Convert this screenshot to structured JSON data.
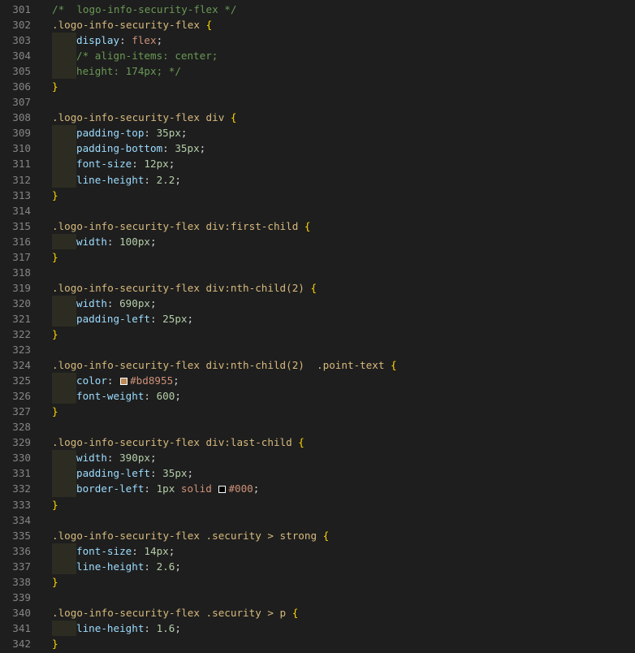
{
  "editor": {
    "lines": [
      {
        "n": "301",
        "indent": false,
        "tokens": [
          {
            "c": "cmt",
            "t": "/*  logo-info-security-flex */"
          }
        ]
      },
      {
        "n": "302",
        "indent": false,
        "tokens": [
          {
            "c": "sel",
            "t": ".logo-info-security-flex "
          },
          {
            "c": "br",
            "t": "{"
          }
        ]
      },
      {
        "n": "303",
        "indent": true,
        "tokens": [
          {
            "c": "prop",
            "t": "display"
          },
          {
            "c": "punc",
            "t": ": "
          },
          {
            "c": "val",
            "t": "flex"
          },
          {
            "c": "punc",
            "t": ";"
          }
        ]
      },
      {
        "n": "304",
        "indent": true,
        "tokens": [
          {
            "c": "cmt",
            "t": "/* align-items: center;"
          }
        ]
      },
      {
        "n": "305",
        "indent": true,
        "tokens": [
          {
            "c": "cmt",
            "t": "height: 174px; */"
          }
        ]
      },
      {
        "n": "306",
        "indent": false,
        "tokens": [
          {
            "c": "br",
            "t": "}"
          }
        ]
      },
      {
        "n": "307",
        "indent": false,
        "tokens": []
      },
      {
        "n": "308",
        "indent": false,
        "tokens": [
          {
            "c": "sel",
            "t": ".logo-info-security-flex div "
          },
          {
            "c": "br",
            "t": "{"
          }
        ]
      },
      {
        "n": "309",
        "indent": true,
        "tokens": [
          {
            "c": "prop",
            "t": "padding-top"
          },
          {
            "c": "punc",
            "t": ": "
          },
          {
            "c": "num",
            "t": "35px"
          },
          {
            "c": "punc",
            "t": ";"
          }
        ]
      },
      {
        "n": "310",
        "indent": true,
        "tokens": [
          {
            "c": "prop",
            "t": "padding-bottom"
          },
          {
            "c": "punc",
            "t": ": "
          },
          {
            "c": "num",
            "t": "35px"
          },
          {
            "c": "punc",
            "t": ";"
          }
        ]
      },
      {
        "n": "311",
        "indent": true,
        "tokens": [
          {
            "c": "prop",
            "t": "font-size"
          },
          {
            "c": "punc",
            "t": ": "
          },
          {
            "c": "num",
            "t": "12px"
          },
          {
            "c": "punc",
            "t": ";"
          }
        ]
      },
      {
        "n": "312",
        "indent": true,
        "tokens": [
          {
            "c": "prop",
            "t": "line-height"
          },
          {
            "c": "punc",
            "t": ": "
          },
          {
            "c": "num",
            "t": "2.2"
          },
          {
            "c": "punc",
            "t": ";"
          }
        ]
      },
      {
        "n": "313",
        "indent": false,
        "tokens": [
          {
            "c": "br",
            "t": "}"
          }
        ]
      },
      {
        "n": "314",
        "indent": false,
        "tokens": []
      },
      {
        "n": "315",
        "indent": false,
        "tokens": [
          {
            "c": "sel",
            "t": ".logo-info-security-flex div:first-child "
          },
          {
            "c": "br",
            "t": "{"
          }
        ]
      },
      {
        "n": "316",
        "indent": true,
        "tokens": [
          {
            "c": "prop",
            "t": "width"
          },
          {
            "c": "punc",
            "t": ": "
          },
          {
            "c": "num",
            "t": "100px"
          },
          {
            "c": "punc",
            "t": ";"
          }
        ]
      },
      {
        "n": "317",
        "indent": false,
        "tokens": [
          {
            "c": "br",
            "t": "}"
          }
        ]
      },
      {
        "n": "318",
        "indent": false,
        "tokens": []
      },
      {
        "n": "319",
        "indent": false,
        "tokens": [
          {
            "c": "sel",
            "t": ".logo-info-security-flex div:nth-child(2) "
          },
          {
            "c": "br",
            "t": "{"
          }
        ]
      },
      {
        "n": "320",
        "indent": true,
        "tokens": [
          {
            "c": "prop",
            "t": "width"
          },
          {
            "c": "punc",
            "t": ": "
          },
          {
            "c": "num",
            "t": "690px"
          },
          {
            "c": "punc",
            "t": ";"
          }
        ]
      },
      {
        "n": "321",
        "indent": true,
        "tokens": [
          {
            "c": "prop",
            "t": "padding-left"
          },
          {
            "c": "punc",
            "t": ": "
          },
          {
            "c": "num",
            "t": "25px"
          },
          {
            "c": "punc",
            "t": ";"
          }
        ]
      },
      {
        "n": "322",
        "indent": false,
        "tokens": [
          {
            "c": "br",
            "t": "}"
          }
        ]
      },
      {
        "n": "323",
        "indent": false,
        "tokens": []
      },
      {
        "n": "324",
        "indent": false,
        "tokens": [
          {
            "c": "sel",
            "t": ".logo-info-security-flex div:nth-child(2)  .point-text "
          },
          {
            "c": "br",
            "t": "{"
          }
        ]
      },
      {
        "n": "325",
        "indent": true,
        "tokens": [
          {
            "c": "prop",
            "t": "color"
          },
          {
            "c": "punc",
            "t": ": "
          },
          {
            "c": "swatch",
            "t": "#bd8955"
          },
          {
            "c": "val",
            "t": "#bd8955"
          },
          {
            "c": "punc",
            "t": ";"
          }
        ]
      },
      {
        "n": "326",
        "indent": true,
        "tokens": [
          {
            "c": "prop",
            "t": "font-weight"
          },
          {
            "c": "punc",
            "t": ": "
          },
          {
            "c": "num",
            "t": "600"
          },
          {
            "c": "punc",
            "t": ";"
          }
        ]
      },
      {
        "n": "327",
        "indent": false,
        "tokens": [
          {
            "c": "br",
            "t": "}"
          }
        ]
      },
      {
        "n": "328",
        "indent": false,
        "tokens": []
      },
      {
        "n": "329",
        "indent": false,
        "tokens": [
          {
            "c": "sel",
            "t": ".logo-info-security-flex div:last-child "
          },
          {
            "c": "br",
            "t": "{"
          }
        ]
      },
      {
        "n": "330",
        "indent": true,
        "tokens": [
          {
            "c": "prop",
            "t": "width"
          },
          {
            "c": "punc",
            "t": ": "
          },
          {
            "c": "num",
            "t": "390px"
          },
          {
            "c": "punc",
            "t": ";"
          }
        ]
      },
      {
        "n": "331",
        "indent": true,
        "tokens": [
          {
            "c": "prop",
            "t": "padding-left"
          },
          {
            "c": "punc",
            "t": ": "
          },
          {
            "c": "num",
            "t": "35px"
          },
          {
            "c": "punc",
            "t": ";"
          }
        ]
      },
      {
        "n": "332",
        "indent": true,
        "tokens": [
          {
            "c": "prop",
            "t": "border-left"
          },
          {
            "c": "punc",
            "t": ": "
          },
          {
            "c": "num",
            "t": "1px"
          },
          {
            "c": "punc",
            "t": " "
          },
          {
            "c": "val",
            "t": "solid"
          },
          {
            "c": "punc",
            "t": " "
          },
          {
            "c": "swatch",
            "t": "#000000"
          },
          {
            "c": "val",
            "t": "#000"
          },
          {
            "c": "punc",
            "t": ";"
          }
        ]
      },
      {
        "n": "333",
        "indent": false,
        "tokens": [
          {
            "c": "br",
            "t": "}"
          }
        ]
      },
      {
        "n": "334",
        "indent": false,
        "tokens": []
      },
      {
        "n": "335",
        "indent": false,
        "tokens": [
          {
            "c": "sel",
            "t": ".logo-info-security-flex .security > strong "
          },
          {
            "c": "br",
            "t": "{"
          }
        ]
      },
      {
        "n": "336",
        "indent": true,
        "tokens": [
          {
            "c": "prop",
            "t": "font-size"
          },
          {
            "c": "punc",
            "t": ": "
          },
          {
            "c": "num",
            "t": "14px"
          },
          {
            "c": "punc",
            "t": ";"
          }
        ]
      },
      {
        "n": "337",
        "indent": true,
        "tokens": [
          {
            "c": "prop",
            "t": "line-height"
          },
          {
            "c": "punc",
            "t": ": "
          },
          {
            "c": "num",
            "t": "2.6"
          },
          {
            "c": "punc",
            "t": ";"
          }
        ]
      },
      {
        "n": "338",
        "indent": false,
        "tokens": [
          {
            "c": "br",
            "t": "}"
          }
        ]
      },
      {
        "n": "339",
        "indent": false,
        "tokens": []
      },
      {
        "n": "340",
        "indent": false,
        "tokens": [
          {
            "c": "sel",
            "t": ".logo-info-security-flex .security > p "
          },
          {
            "c": "br",
            "t": "{"
          }
        ]
      },
      {
        "n": "341",
        "indent": true,
        "tokens": [
          {
            "c": "prop",
            "t": "line-height"
          },
          {
            "c": "punc",
            "t": ": "
          },
          {
            "c": "num",
            "t": "1.6"
          },
          {
            "c": "punc",
            "t": ";"
          }
        ]
      },
      {
        "n": "342",
        "indent": false,
        "tokens": [
          {
            "c": "br",
            "t": "}"
          }
        ]
      }
    ]
  }
}
